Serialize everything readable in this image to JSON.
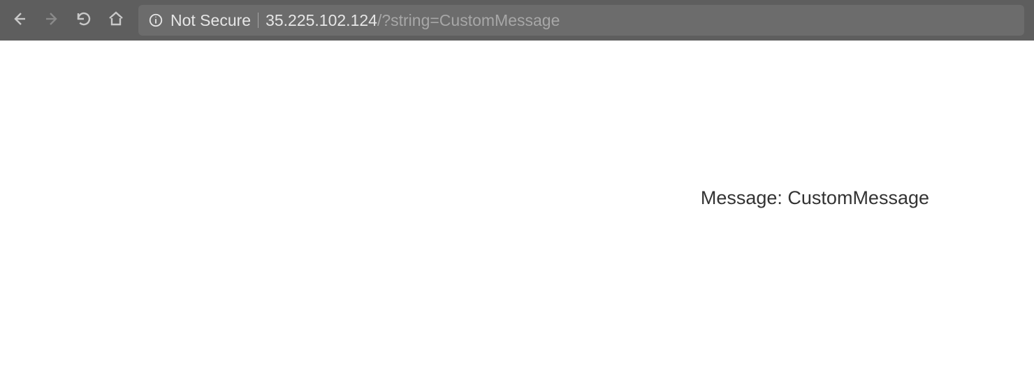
{
  "toolbar": {
    "security_label": "Not Secure",
    "url_host": "35.225.102.124",
    "url_path": "/?string=CustomMessage"
  },
  "page": {
    "message": "Message: CustomMessage"
  }
}
